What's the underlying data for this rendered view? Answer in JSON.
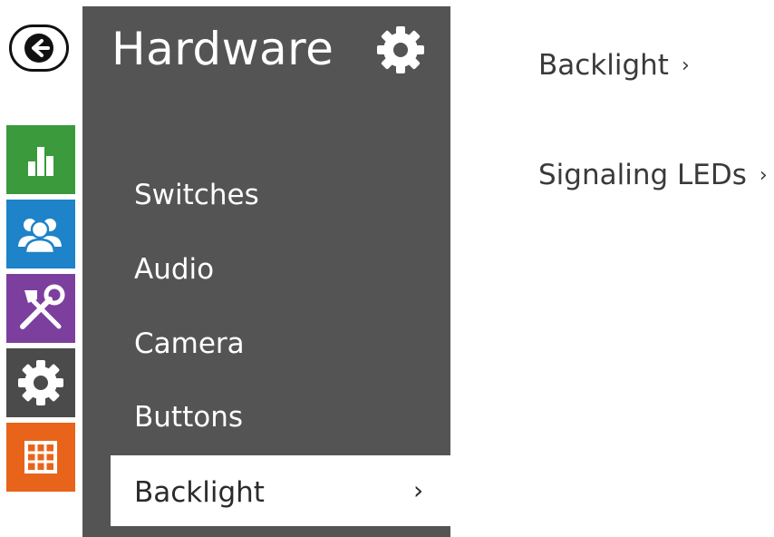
{
  "header": {
    "title": "Hardware",
    "settings_icon": "gear-icon"
  },
  "nav_rail": [
    {
      "name": "back",
      "icon": "arrow-left-icon"
    },
    {
      "name": "status",
      "icon": "bar-chart-icon",
      "color": "#3a9a3c"
    },
    {
      "name": "users",
      "icon": "users-icon",
      "color": "#1e83c8"
    },
    {
      "name": "services",
      "icon": "tools-icon",
      "color": "#7d3f9e"
    },
    {
      "name": "hardware",
      "icon": "gear-icon",
      "color": "#4b4b4b"
    },
    {
      "name": "system",
      "icon": "grid-icon",
      "color": "#e8641b"
    }
  ],
  "menu": {
    "items": [
      "Switches",
      "Audio",
      "Camera",
      "Buttons"
    ],
    "selected": {
      "label": "Backlight",
      "chevron": "›"
    }
  },
  "content": {
    "links": [
      {
        "label": "Backlight",
        "chevron": "›"
      },
      {
        "label": "Signaling LEDs",
        "chevron": "›"
      }
    ]
  },
  "colors": {
    "panel_bg": "#545454",
    "selected_bg": "#ffffff"
  }
}
